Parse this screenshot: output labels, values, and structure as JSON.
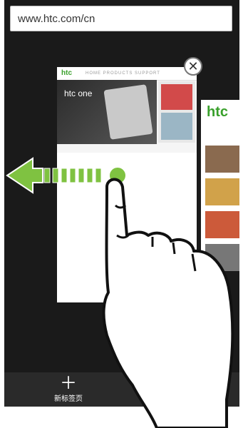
{
  "browser": {
    "url": "www.htc.com/cn",
    "new_tab_label": "新标签页"
  },
  "tab_preview": {
    "logo": "htc",
    "banner_text": "htc one",
    "nav": "HOME PRODUCTS SUPPORT"
  },
  "second_preview": {
    "logo": "htc"
  },
  "colors": {
    "gesture_arrow": "#7fc241",
    "background": "#1a1a1a"
  },
  "icons": {
    "close": "close-icon",
    "add": "plus-icon"
  }
}
